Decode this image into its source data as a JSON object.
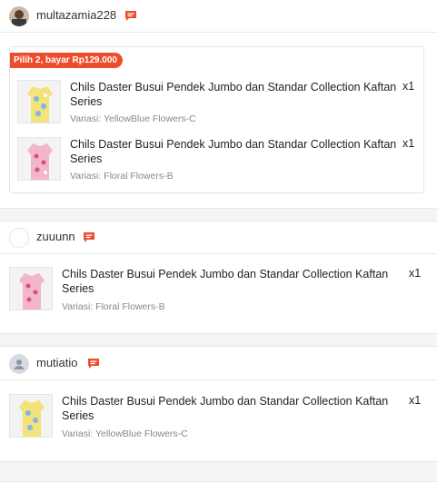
{
  "orders": [
    {
      "username": "multazamia228",
      "bundle_badge": "Pilih 2, bayar Rp129.000",
      "items": [
        {
          "name": "Chils Daster Busui Pendek Jumbo dan Standar Collection Kaftan Series",
          "qty": "x1",
          "variant": "Variasi: YellowBlue Flowers-C"
        },
        {
          "name": "Chils Daster Busui Pendek Jumbo dan Standar Collection Kaftan Series",
          "qty": "x1",
          "variant": "Variasi: Floral Flowers-B"
        }
      ]
    },
    {
      "username": "zuuunn",
      "items": [
        {
          "name": "Chils Daster Busui Pendek Jumbo dan Standar Collection Kaftan Series",
          "qty": "x1",
          "variant": "Variasi: Floral Flowers-B"
        }
      ]
    },
    {
      "username": "mutiatio",
      "items": [
        {
          "name": "Chils Daster Busui Pendek Jumbo dan Standar Collection Kaftan Series",
          "qty": "x1",
          "variant": "Variasi: YellowBlue Flowers-C"
        }
      ]
    }
  ],
  "colors": {
    "accent": "#ee4d2d",
    "variant_text": "#888888"
  }
}
